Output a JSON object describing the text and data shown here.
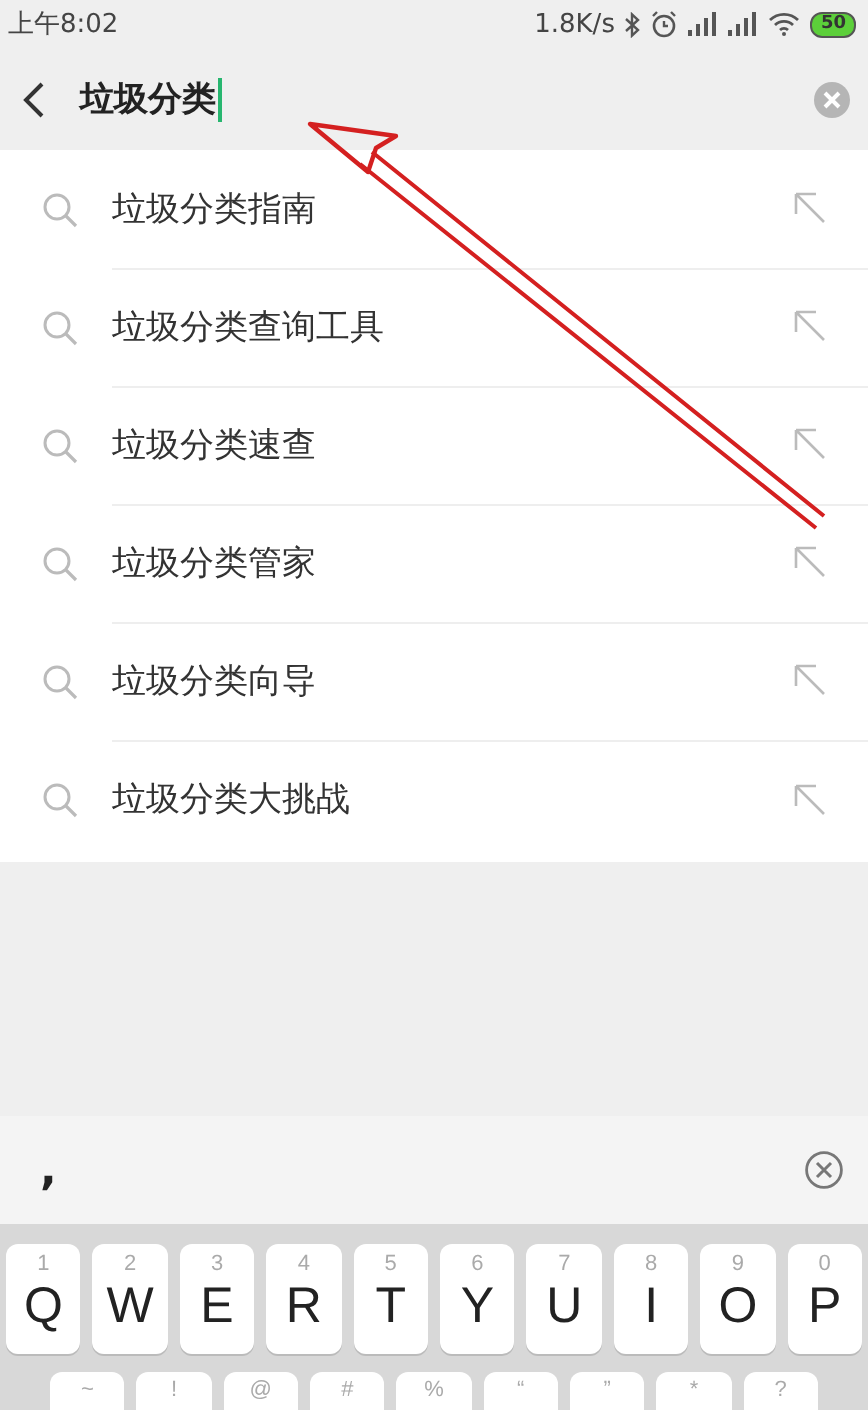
{
  "status_bar": {
    "time": "上午8:02",
    "speed": "1.8K/s",
    "battery": "50"
  },
  "search": {
    "value": "垃圾分类"
  },
  "suggestions": [
    {
      "text": "垃圾分类指南"
    },
    {
      "text": "垃圾分类查询工具"
    },
    {
      "text": "垃圾分类速查"
    },
    {
      "text": "垃圾分类管家"
    },
    {
      "text": "垃圾分类向导"
    },
    {
      "text": "垃圾分类大挑战"
    }
  ],
  "candidate_bar": {
    "candidate": ","
  },
  "keyboard": {
    "letter_row": [
      {
        "label": "Q",
        "hint": "1"
      },
      {
        "label": "W",
        "hint": "2"
      },
      {
        "label": "E",
        "hint": "3"
      },
      {
        "label": "R",
        "hint": "4"
      },
      {
        "label": "T",
        "hint": "5"
      },
      {
        "label": "Y",
        "hint": "6"
      },
      {
        "label": "U",
        "hint": "7"
      },
      {
        "label": "I",
        "hint": "8"
      },
      {
        "label": "O",
        "hint": "9"
      },
      {
        "label": "P",
        "hint": "0"
      }
    ],
    "symbol_row": [
      {
        "hint": "~"
      },
      {
        "hint": "!"
      },
      {
        "hint": "@"
      },
      {
        "hint": "#"
      },
      {
        "hint": "%"
      },
      {
        "hint": "“"
      },
      {
        "hint": "”"
      },
      {
        "hint": "*"
      },
      {
        "hint": "?"
      }
    ]
  }
}
